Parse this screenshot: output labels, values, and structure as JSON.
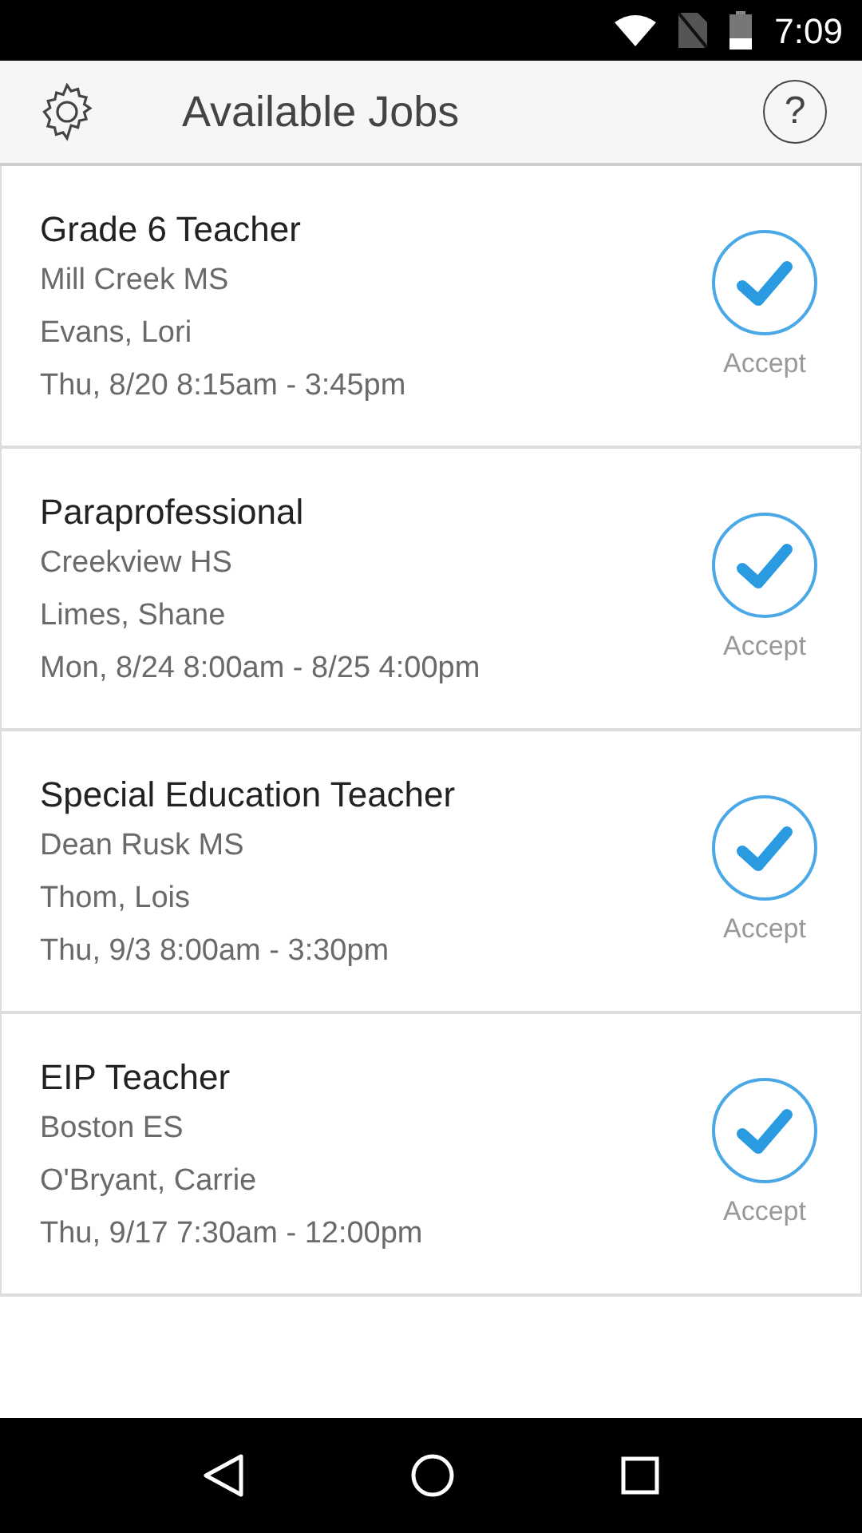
{
  "status_bar": {
    "time": "7:09"
  },
  "header": {
    "title": "Available Jobs",
    "help": "?"
  },
  "jobs": [
    {
      "title": "Grade 6 Teacher",
      "school": "Mill Creek MS",
      "person": "Evans, Lori",
      "when": "Thu, 8/20 8:15am - 3:45pm",
      "action": "Accept"
    },
    {
      "title": "Paraprofessional",
      "school": "Creekview HS",
      "person": "Limes, Shane",
      "when": "Mon, 8/24 8:00am - 8/25 4:00pm",
      "action": "Accept"
    },
    {
      "title": "Special Education Teacher",
      "school": "Dean Rusk MS",
      "person": "Thom, Lois",
      "when": "Thu, 9/3 8:00am - 3:30pm",
      "action": "Accept"
    },
    {
      "title": "EIP Teacher",
      "school": "Boston ES",
      "person": "O'Bryant, Carrie",
      "when": "Thu, 9/17 7:30am - 12:00pm",
      "action": "Accept"
    }
  ]
}
